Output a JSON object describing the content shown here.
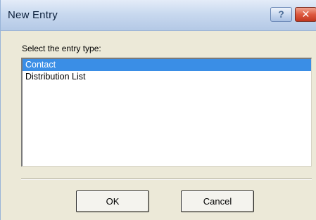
{
  "window": {
    "title": "New Entry",
    "help_glyph": "?",
    "close_glyph": "✕"
  },
  "dialog": {
    "prompt": "Select the entry type:",
    "entry_types": [
      {
        "label": "Contact",
        "selected": true
      },
      {
        "label": "Distribution List",
        "selected": false
      }
    ],
    "ok_label": "OK",
    "cancel_label": "Cancel"
  },
  "colors": {
    "selection": "#3a8ee6",
    "dialog_face": "#ece9d8",
    "titlebar": "#c9d9ef",
    "close_button": "#dd5a40"
  },
  "icons": {
    "help": "help-icon",
    "close": "close-icon"
  }
}
